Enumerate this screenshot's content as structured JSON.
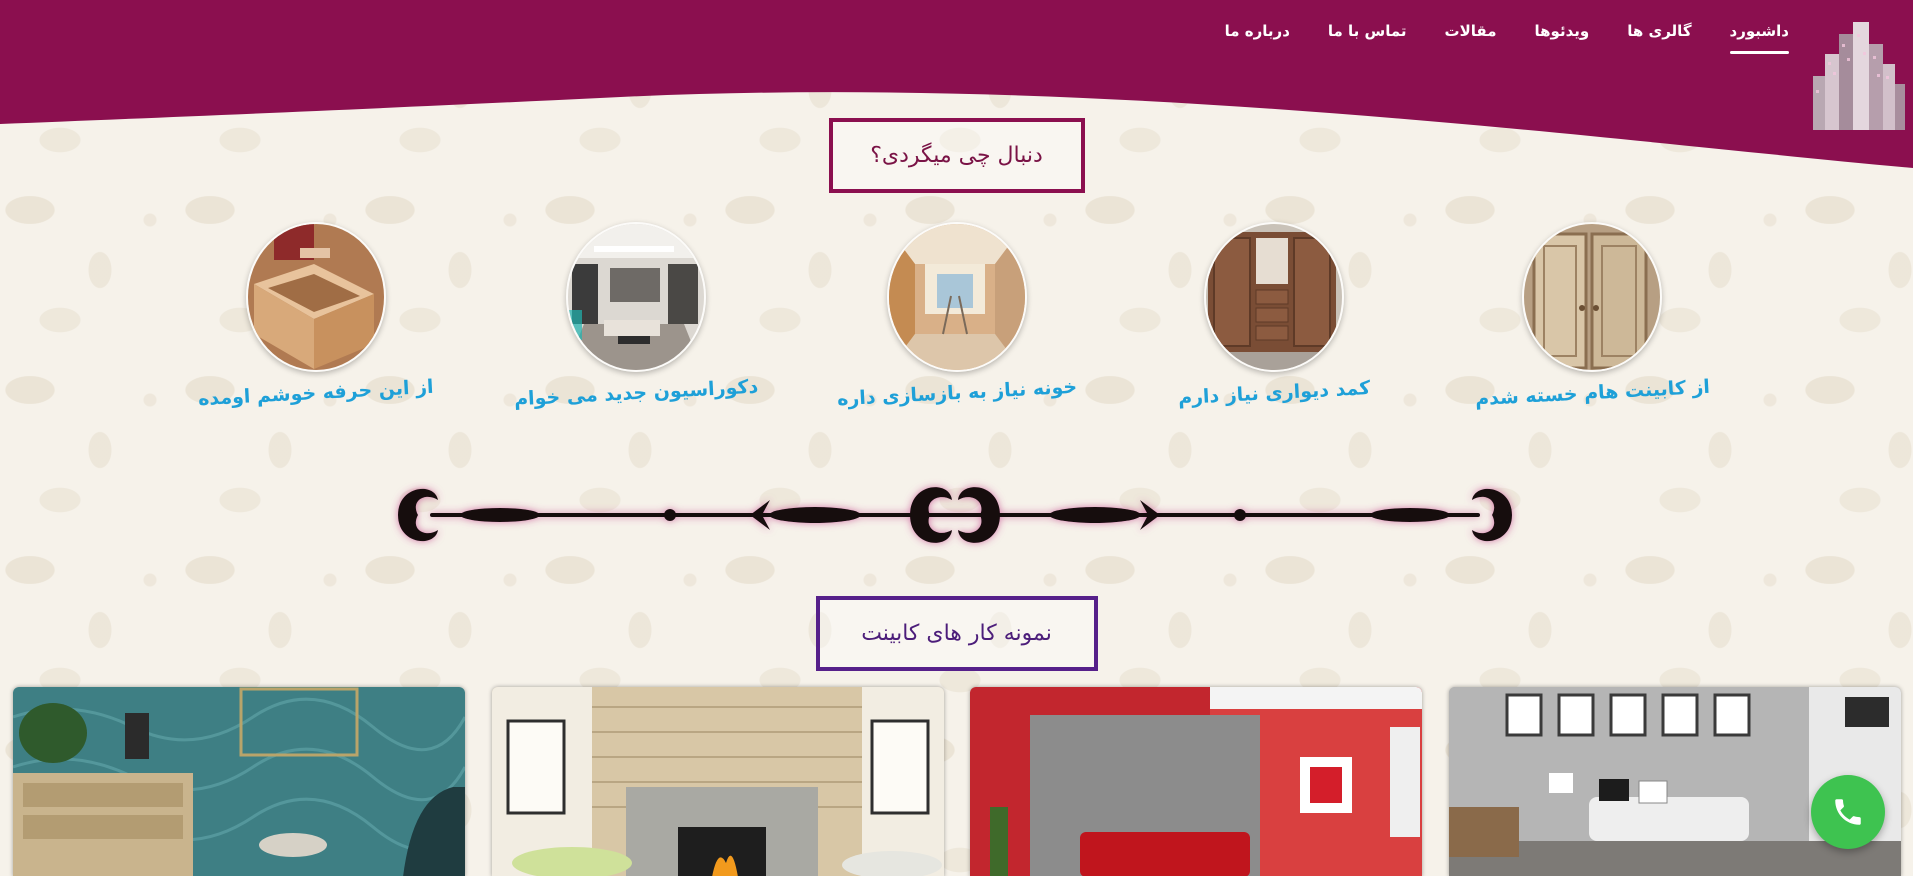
{
  "colors": {
    "header": "#8b0f4f",
    "title_1_border": "#8b0f4f",
    "title_2_border": "#56208a",
    "category_label": "#1ea0d8",
    "phone_button": "#3ec350"
  },
  "nav": {
    "items": [
      {
        "label": "داشبورد",
        "active": true
      },
      {
        "label": "گالری ها",
        "active": false
      },
      {
        "label": "ویدئوها",
        "active": false
      },
      {
        "label": "مقالات",
        "active": false
      },
      {
        "label": "تماس با ما",
        "active": false
      },
      {
        "label": "درباره ما",
        "active": false
      }
    ],
    "logo_icon": "city-skyline-logo"
  },
  "section_search": {
    "title": "دنبال چی میگردی؟",
    "categories": [
      {
        "label": "از کابینت هام خسته شدم",
        "icon": "old-cabinet-image"
      },
      {
        "label": "کمد دیواری نیاز دارم",
        "icon": "wall-closet-image"
      },
      {
        "label": "خونه نیاز به بازسازی داره",
        "icon": "renovation-image"
      },
      {
        "label": "دکوراسیون جدید می خوام",
        "icon": "living-room-image"
      },
      {
        "label": "از این حرفه خوشم اومده",
        "icon": "carpentry-image"
      }
    ]
  },
  "section_samples": {
    "title": "نمونه کار های کابینت",
    "cards": [
      {
        "icon": "gallery-wall-room-image"
      },
      {
        "icon": "red-wall-room-image"
      },
      {
        "icon": "fireplace-room-image"
      },
      {
        "icon": "teal-wallpaper-room-image"
      }
    ]
  },
  "contact": {
    "icon": "phone-icon"
  }
}
